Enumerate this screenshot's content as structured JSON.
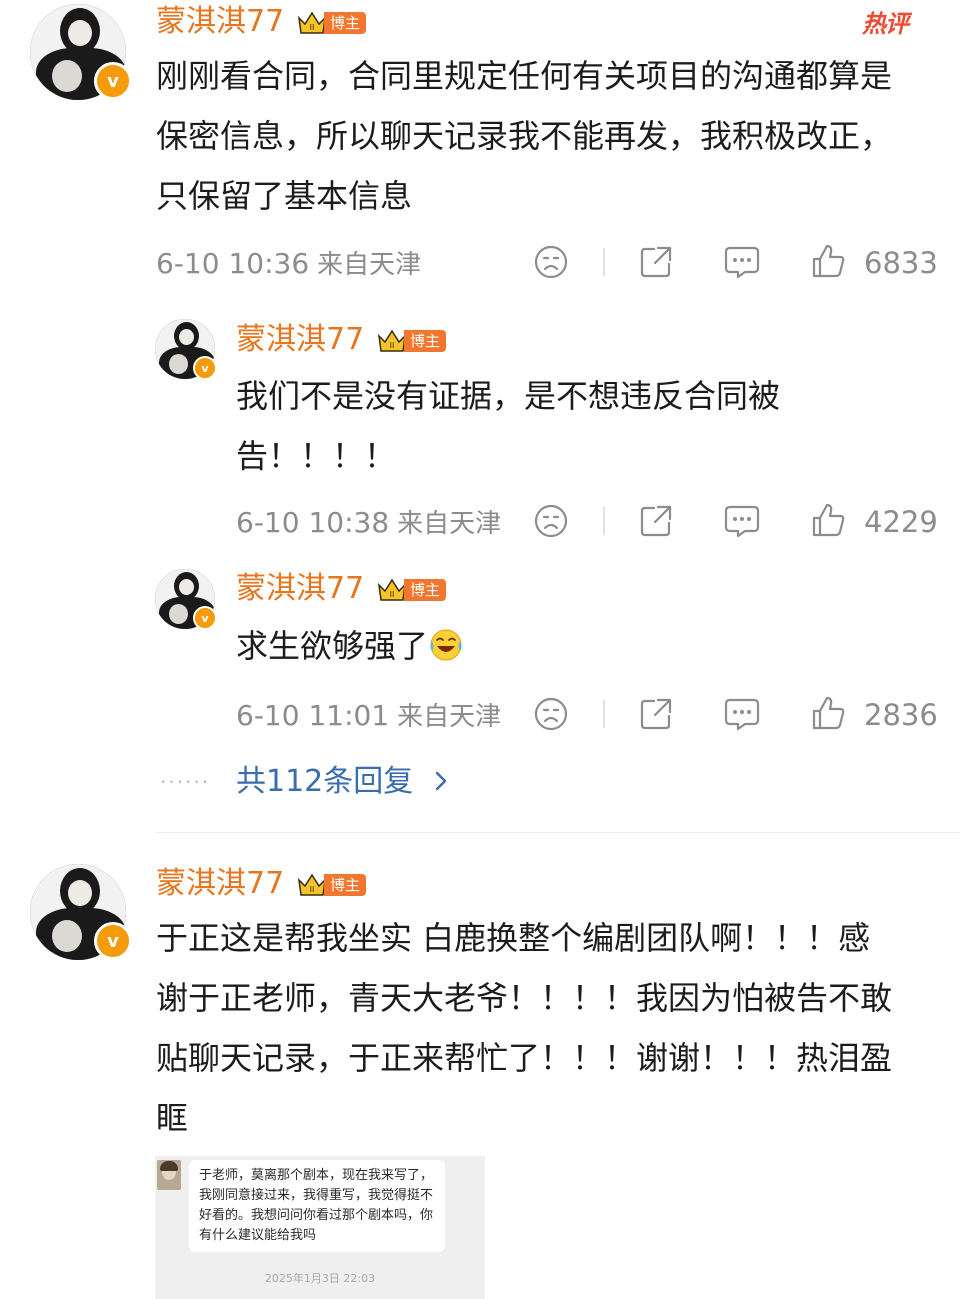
{
  "hot_label": "热评",
  "main_comment": {
    "author": "蒙淇淇77",
    "badge": "博主",
    "text": "刚刚看合同，合同里规定任何有关项目的沟通都算是保密信息，所以聊天记录我不能再发，我积极改正，只保留了基本信息",
    "time": "6-10 10:36",
    "source": "来自天津",
    "likes": "6833"
  },
  "replies": [
    {
      "author": "蒙淇淇77",
      "badge": "博主",
      "text": "我们不是没有证据，是不想违反合同被告！！！！",
      "time": "6-10 10:38",
      "source": "来自天津",
      "likes": "4229"
    },
    {
      "author": "蒙淇淇77",
      "badge": "博主",
      "text": "求生欲够强了",
      "emoji": "laugh-cry-emoji",
      "time": "6-10 11:01",
      "source": "来自天津",
      "likes": "2836"
    }
  ],
  "more_replies": "共112条回复",
  "second_comment": {
    "author": "蒙淇淇77",
    "badge": "博主",
    "text": "于正这是帮我坐实 白鹿换整个编剧团队啊！！！感谢于正老师，青天大老爷！！！！我因为怕被告不敢贴聊天记录，于正来帮忙了！！！谢谢！！！热泪盈眶",
    "image": {
      "message": "于老师，莫离那个剧本，现在我来写了，我刚同意接过来，我得重写，我觉得挺不好看的。我想问问你看过那个剧本吗，你有什么建议能给我吗",
      "timestamp": "2025年1月3日 22:03"
    }
  },
  "icons": {
    "dislike": "frown-face-icon",
    "share": "share-icon",
    "comment": "comment-bubble-icon",
    "like": "thumb-up-icon",
    "verified": "verified-v-icon",
    "crown": "crown-badge-icon"
  },
  "colors": {
    "name": "#e8761f",
    "badge": "#f2762d",
    "link": "#3a6dad",
    "hot": "#ef4b35",
    "meta": "#8c8c8c"
  }
}
